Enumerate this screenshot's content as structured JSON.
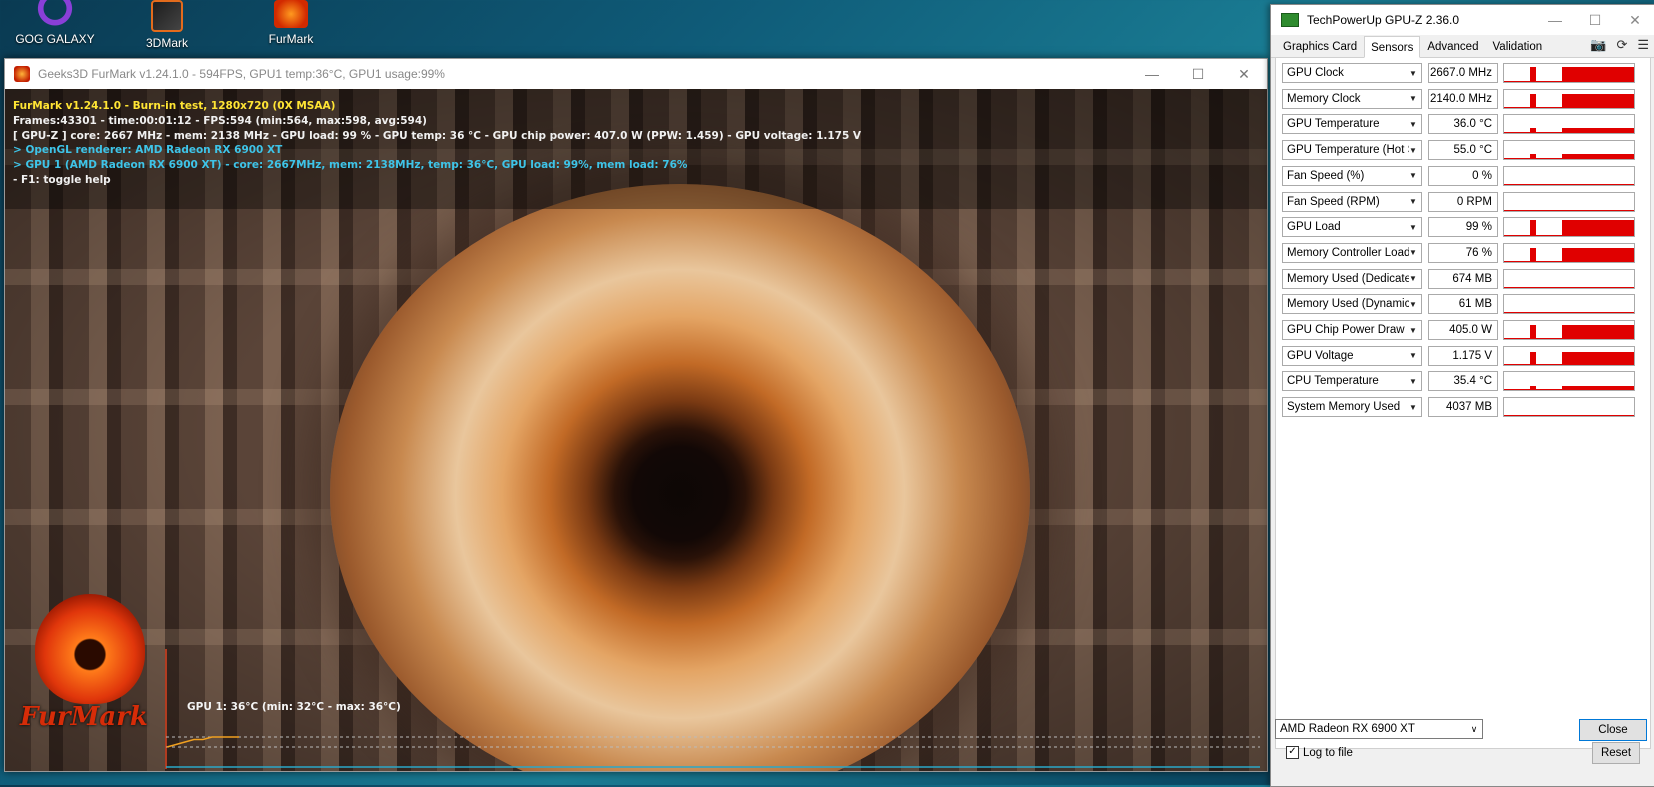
{
  "desktop": {
    "icons": [
      {
        "label": "GOG GALAXY"
      },
      {
        "label": "3DMark"
      },
      {
        "label": "FurMark"
      }
    ]
  },
  "furmark": {
    "title": "Geeks3D FurMark v1.24.1.0 - 594FPS, GPU1 temp:36°C, GPU1 usage:99%",
    "hud": {
      "line1": "FurMark v1.24.1.0 - Burn-in test, 1280x720 (0X MSAA)",
      "line2": "Frames:43301 - time:00:01:12 - FPS:594 (min:564, max:598, avg:594)",
      "line3": "[ GPU-Z ] core: 2667 MHz - mem: 2138 MHz - GPU load: 99 % - GPU temp: 36 °C - GPU chip power: 407.0 W (PPW: 1.459) - GPU voltage: 1.175 V",
      "line4": "> OpenGL renderer: AMD Radeon RX 6900 XT",
      "line5": "> GPU 1 (AMD Radeon RX 6900 XT) - core: 2667MHz, mem: 2138MHz, temp: 36°C, GPU load: 99%, mem load: 76%",
      "line6": "- F1: toggle help"
    },
    "logo_text": "FurMark",
    "graph_label": "GPU 1: 36°C (min: 32°C - max: 36°C)",
    "temperature_history_c": [
      32,
      33,
      34,
      35,
      35,
      36,
      36,
      36,
      36
    ]
  },
  "gpuz": {
    "title": "TechPowerUp GPU-Z 2.36.0",
    "tabs": [
      "Graphics Card",
      "Sensors",
      "Advanced",
      "Validation"
    ],
    "active_tab": "Sensors",
    "sensors": [
      {
        "name": "GPU Clock",
        "value": "2667.0 MHz",
        "level": 0.85
      },
      {
        "name": "Memory Clock",
        "value": "2140.0 MHz",
        "level": 0.75
      },
      {
        "name": "GPU Temperature",
        "value": "36.0 °C",
        "level": 0.25
      },
      {
        "name": "GPU Temperature (Hot Spot)",
        "value": "55.0 °C",
        "level": 0.3
      },
      {
        "name": "Fan Speed (%)",
        "value": "0 %",
        "level": 0
      },
      {
        "name": "Fan Speed (RPM)",
        "value": "0 RPM",
        "level": 0
      },
      {
        "name": "GPU Load",
        "value": "99 %",
        "level": 0.9
      },
      {
        "name": "Memory Controller Load",
        "value": "76 %",
        "level": 0.75
      },
      {
        "name": "Memory Used (Dedicated)",
        "value": "674 MB",
        "level": 0.05
      },
      {
        "name": "Memory Used (Dynamic)",
        "value": "61 MB",
        "level": 0
      },
      {
        "name": "GPU Chip Power Draw",
        "value": "405.0 W",
        "level": 0.8
      },
      {
        "name": "GPU Voltage",
        "value": "1.175 V",
        "level": 0.7
      },
      {
        "name": "CPU Temperature",
        "value": "35.4 °C",
        "level": 0.2
      },
      {
        "name": "System Memory Used",
        "value": "4037 MB",
        "level": 0.05
      }
    ],
    "log_to_file_label": "Log to file",
    "log_to_file_checked": true,
    "reset_label": "Reset",
    "card_select": "AMD Radeon RX 6900 XT",
    "close_label": "Close",
    "graph_color": "#e00000"
  }
}
